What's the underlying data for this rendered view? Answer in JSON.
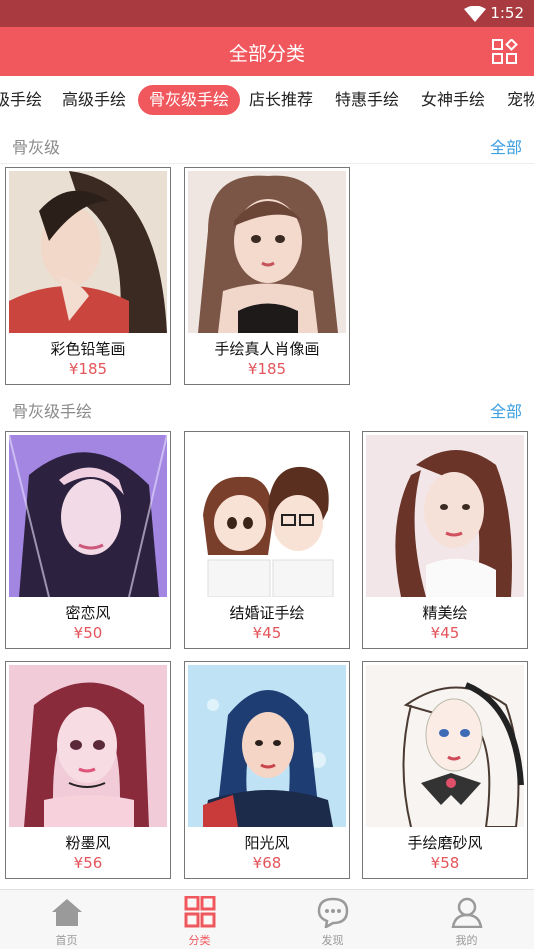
{
  "status_bar": {
    "time": "1:52"
  },
  "header": {
    "title": "全部分类"
  },
  "tabs": [
    {
      "label": "级手绘"
    },
    {
      "label": "高级手绘"
    },
    {
      "label": "骨灰级手绘",
      "active": true
    },
    {
      "label": "店长推荐"
    },
    {
      "label": "特惠手绘"
    },
    {
      "label": "女神手绘"
    },
    {
      "label": "宠物"
    }
  ],
  "sections": [
    {
      "title": "骨灰级",
      "all_label": "全部",
      "items": [
        {
          "name": "彩色铅笔画",
          "price": "¥185"
        },
        {
          "name": "手绘真人肖像画",
          "price": "¥185"
        }
      ]
    },
    {
      "title": "骨灰级手绘",
      "all_label": "全部",
      "items": [
        {
          "name": "密恋风",
          "price": "¥50"
        },
        {
          "name": "结婚证手绘",
          "price": "¥45"
        },
        {
          "name": "精美绘",
          "price": "¥45"
        },
        {
          "name": "粉墨风",
          "price": "¥56"
        },
        {
          "name": "阳光风",
          "price": "¥68"
        },
        {
          "name": "手绘磨砂风",
          "price": "¥58"
        }
      ]
    }
  ],
  "bottom_nav": [
    {
      "label": "首页",
      "icon": "home-icon"
    },
    {
      "label": "分类",
      "icon": "category-icon",
      "active": true
    },
    {
      "label": "发现",
      "icon": "chat-bubble-icon"
    },
    {
      "label": "我的",
      "icon": "user-icon"
    }
  ],
  "colors": {
    "primary": "#f0585e",
    "status_bar": "#a83a40",
    "link": "#3c9fe0",
    "price": "#e3555b"
  }
}
